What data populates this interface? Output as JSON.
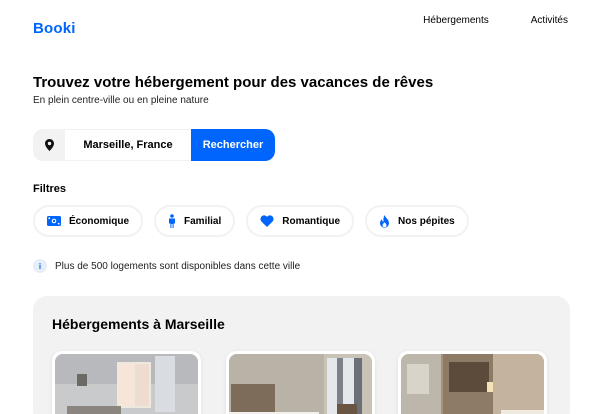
{
  "header": {
    "logo": "Booki",
    "nav": [
      {
        "label": "Hébergements"
      },
      {
        "label": "Activités"
      }
    ]
  },
  "hero": {
    "title": "Trouvez votre hébergement pour des vacances de rêves",
    "subtitle": "En plein centre-ville ou en pleine nature"
  },
  "search": {
    "icon": "location-pin-icon",
    "value": "Marseille, France",
    "button_label": "Rechercher"
  },
  "filters": {
    "title": "Filtres",
    "items": [
      {
        "label": "Économique",
        "icon": "money-icon"
      },
      {
        "label": "Familial",
        "icon": "person-icon"
      },
      {
        "label": "Romantique",
        "icon": "heart-icon"
      },
      {
        "label": "Nos pépites",
        "icon": "fire-icon"
      }
    ]
  },
  "info": {
    "icon": "info-icon",
    "text": "Plus de 500 logements sont disponibles dans cette ville"
  },
  "accommodations": {
    "title": "Hébergements à Marseille",
    "cards": [
      {
        "image": "room-photo-1"
      },
      {
        "image": "room-photo-2"
      },
      {
        "image": "room-photo-3"
      }
    ]
  },
  "colors": {
    "accent": "#0065fc",
    "panel": "#f2f2f2"
  }
}
